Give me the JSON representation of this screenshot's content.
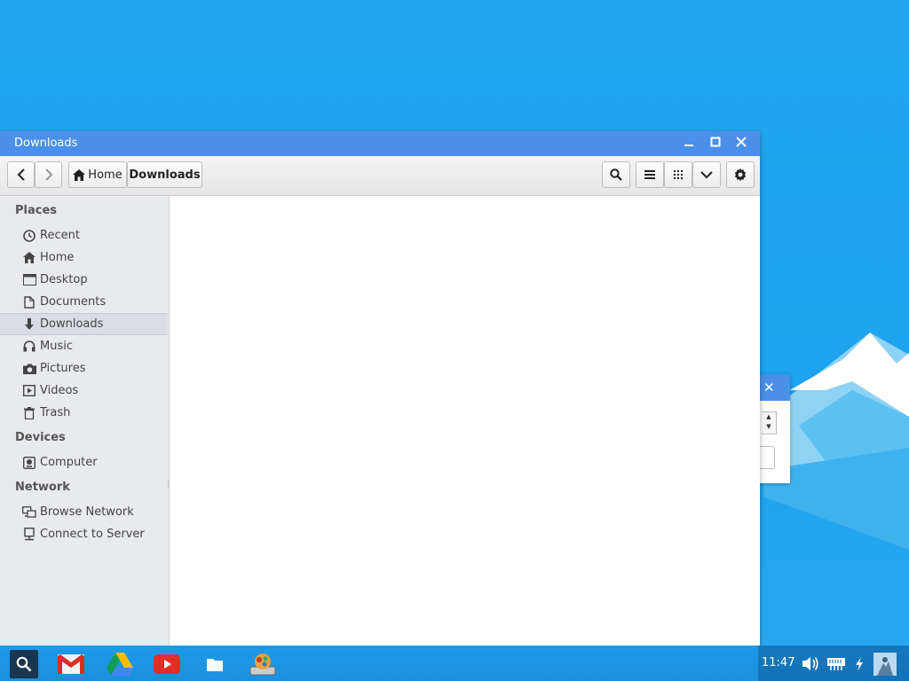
{
  "window": {
    "title": "Downloads",
    "controls": {
      "minimize": "–",
      "maximize": "◻",
      "close": "✕"
    }
  },
  "toolbar": {
    "back_icon": "‹",
    "forward_icon": "›",
    "breadcrumb": [
      {
        "label": "Home",
        "icon": "home-icon"
      },
      {
        "label": "Downloads"
      }
    ]
  },
  "sidebar": {
    "sections": {
      "places": "Places",
      "devices": "Devices",
      "network": "Network"
    },
    "places": [
      {
        "label": "Recent",
        "icon": "clock-icon"
      },
      {
        "label": "Home",
        "icon": "home-icon"
      },
      {
        "label": "Desktop",
        "icon": "desktop-icon"
      },
      {
        "label": "Documents",
        "icon": "document-icon"
      },
      {
        "label": "Downloads",
        "icon": "download-icon"
      },
      {
        "label": "Music",
        "icon": "headphones-icon"
      },
      {
        "label": "Pictures",
        "icon": "camera-icon"
      },
      {
        "label": "Videos",
        "icon": "video-icon"
      },
      {
        "label": "Trash",
        "icon": "trash-icon"
      }
    ],
    "devices": [
      {
        "label": "Computer",
        "icon": "drive-icon"
      }
    ],
    "network": [
      {
        "label": "Browse Network",
        "icon": "network-icon"
      },
      {
        "label": "Connect to Server",
        "icon": "server-icon"
      }
    ]
  },
  "taskbar": {
    "apps": [
      "search-icon",
      "gmail-icon",
      "drive-icon",
      "youtube-icon",
      "files-icon",
      "app-icon"
    ],
    "clock": "11:47"
  },
  "colors": {
    "accent": "#4a8fea",
    "desktop": "#22a6f0"
  }
}
